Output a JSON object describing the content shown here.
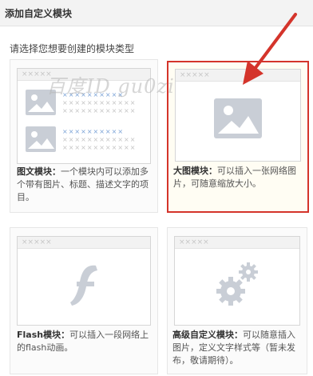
{
  "header": {
    "title": "添加自定义模块"
  },
  "prompt": "请选择您想要创建的模块类型",
  "watermark": "百度ID gu0zi",
  "thumb_placeholder": "×××××",
  "cards": [
    {
      "title": "图文模块：",
      "desc": "一个模块内可以添加多个带有图片、标题、描述文字的项目。",
      "icon": "image-text-icon"
    },
    {
      "title": "大图模块：",
      "desc": "可以插入一张网络图片，可随意缩放大小。",
      "icon": "image-icon"
    },
    {
      "title": "Flash模块：",
      "desc": "可以插入一段网络上的flash动画。",
      "icon": "flash-icon"
    },
    {
      "title": "高级自定义模块：",
      "desc": "可以随意插入图片，定义文字样式等（暂未发布，敬请期待）。",
      "icon": "gear-icon"
    }
  ],
  "colors": {
    "selected_border": "#d4342b",
    "icon_gray": "#c9ced6",
    "link_blue": "#7aa2d6"
  }
}
